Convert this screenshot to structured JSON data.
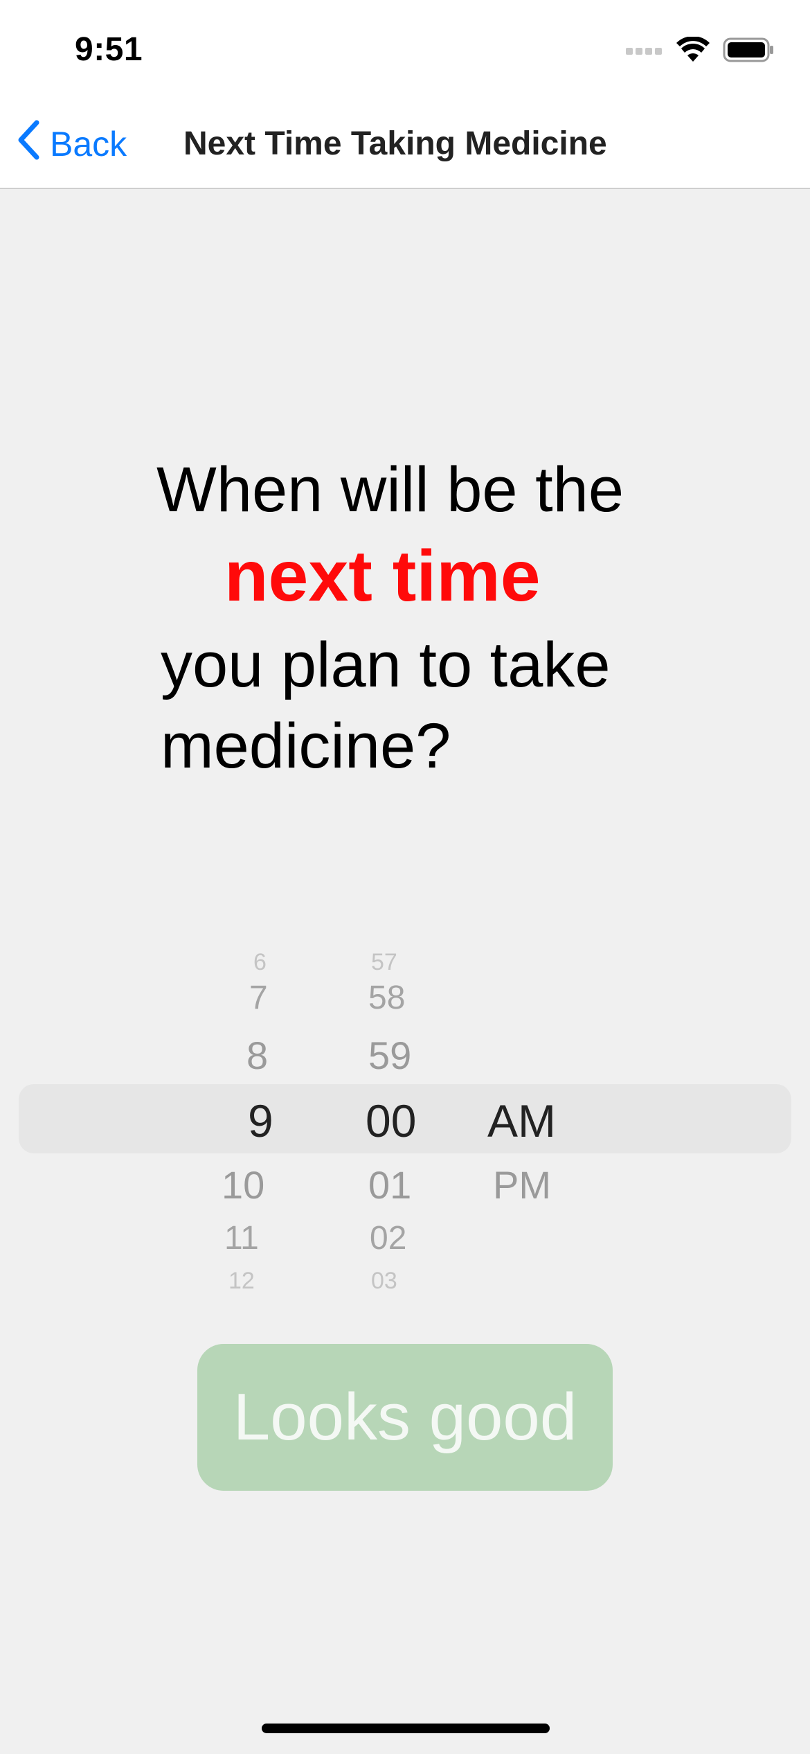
{
  "status_bar": {
    "time": "9:51"
  },
  "nav": {
    "back_label": "Back",
    "title": "Next Time Taking Medicine"
  },
  "question": {
    "line1": "When will be the",
    "highlight": "next time",
    "line3": "you plan to take",
    "line4": "medicine?"
  },
  "picker": {
    "hours": [
      "6",
      "7",
      "8",
      "9",
      "10",
      "11",
      "12"
    ],
    "minutes": [
      "57",
      "58",
      "59",
      "00",
      "01",
      "02",
      "03"
    ],
    "periods": [
      "AM",
      "PM"
    ],
    "selected_hour": "9",
    "selected_minute": "00",
    "selected_period": "AM"
  },
  "button": {
    "label": "Looks good"
  },
  "colors": {
    "accent": "#0a7aff",
    "highlight": "#ff0a0a",
    "button_bg": "#b7d6b7"
  }
}
